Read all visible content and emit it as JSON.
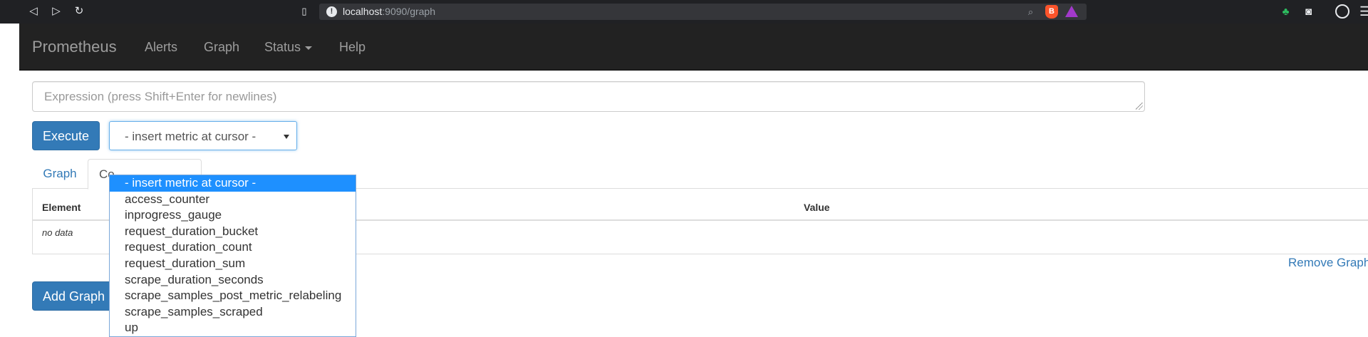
{
  "browser": {
    "url_host": "localhost",
    "url_path": ":9090/graph",
    "back_icon": "back-triangle-icon",
    "forward_icon": "forward-triangle-icon",
    "reload_icon": "reload-icon"
  },
  "navbar": {
    "brand": "Prometheus",
    "links": [
      "Alerts",
      "Graph",
      "Status",
      "Help"
    ]
  },
  "expression": {
    "placeholder": "Expression (press Shift+Enter for newlines)"
  },
  "execute_label": "Execute",
  "metric_select": {
    "value": "- insert metric at cursor -",
    "options": [
      "- insert metric at cursor -",
      "access_counter",
      "inprogress_gauge",
      "request_duration_bucket",
      "request_duration_count",
      "request_duration_sum",
      "scrape_duration_seconds",
      "scrape_samples_post_metric_relabeling",
      "scrape_samples_scraped",
      "up"
    ]
  },
  "tabs": [
    "Graph",
    "Co"
  ],
  "table": {
    "headers": [
      "Element",
      "Value"
    ],
    "empty_text": "no data"
  },
  "remove_graph_label": "Remove Graph",
  "add_graph_label": "Add Graph",
  "colors": {
    "primary": "#337ab7",
    "navbar": "#222222",
    "selected_option": "#1e90ff"
  }
}
